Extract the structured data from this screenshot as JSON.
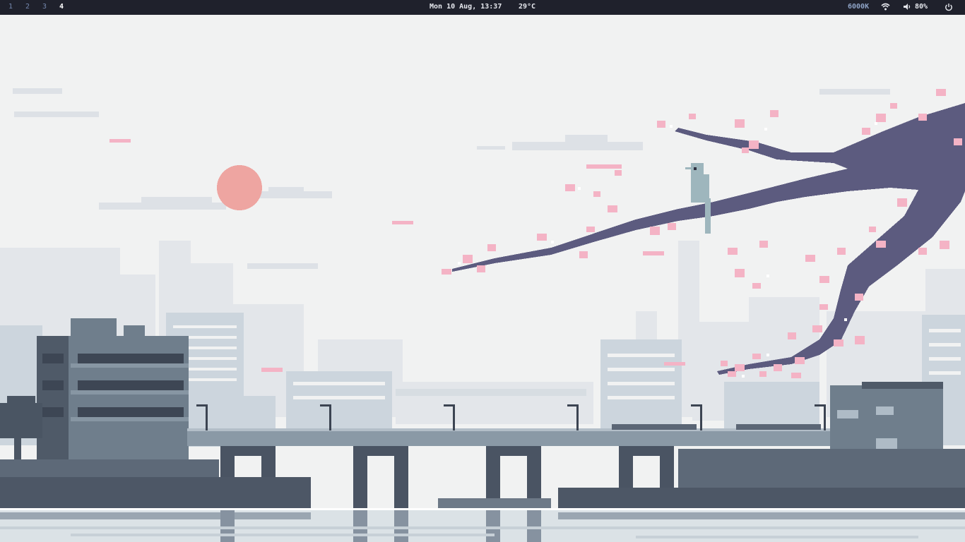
{
  "topbar": {
    "workspaces": [
      {
        "label": "1",
        "active": false
      },
      {
        "label": "2",
        "active": false
      },
      {
        "label": "3",
        "active": false
      },
      {
        "label": "4",
        "active": true
      }
    ],
    "datetime": "Mon 10 Aug, 13:37",
    "temperature": "29°C",
    "color_temp": "6000K",
    "volume": "80%",
    "icons": [
      "wifi-icon",
      "volume-icon",
      "power-icon"
    ]
  },
  "colors": {
    "bar_bg": "#1f212c",
    "sky": "#f1f2f2",
    "sun": "#eea5a1",
    "blossom": "#f4b3c5",
    "branch": "#5c5b7f",
    "bird": "#9eb6bd",
    "building_dark": "#6a7a88",
    "building_light": "#d4dbe1",
    "water": "#dbe2e6"
  }
}
